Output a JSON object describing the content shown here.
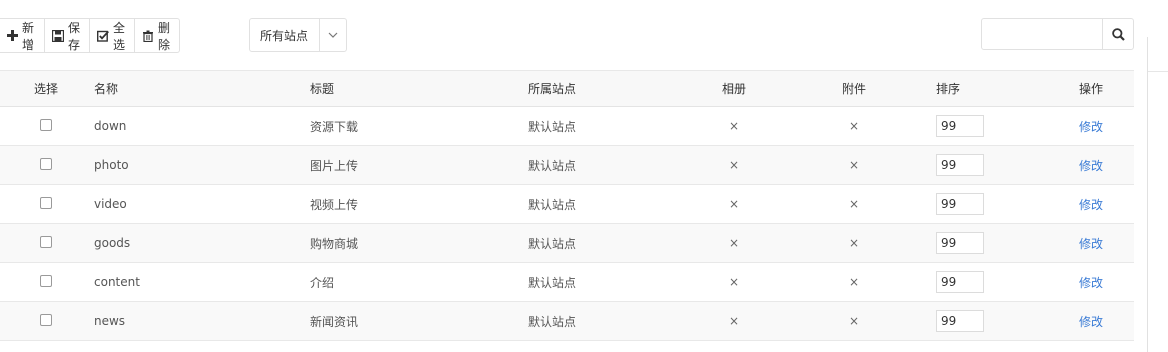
{
  "toolbar": {
    "buttons": [
      {
        "label": "新增",
        "icon": "plus-icon"
      },
      {
        "label": "保存",
        "icon": "save-icon"
      },
      {
        "label": "全选",
        "icon": "check-square-icon"
      },
      {
        "label": "删除",
        "icon": "trash-icon"
      }
    ],
    "site_select": {
      "value": "所有站点"
    },
    "search": {
      "placeholder": "",
      "value": ""
    }
  },
  "table": {
    "headers": {
      "select": "选择",
      "name": "名称",
      "title": "标题",
      "site": "所属站点",
      "album": "相册",
      "attachment": "附件",
      "sort": "排序",
      "action": "操作"
    },
    "rows": [
      {
        "name": "down",
        "title": "资源下载",
        "site": "默认站点",
        "album": "×",
        "attachment": "×",
        "sort": "99",
        "action": "修改"
      },
      {
        "name": "photo",
        "title": "图片上传",
        "site": "默认站点",
        "album": "×",
        "attachment": "×",
        "sort": "99",
        "action": "修改"
      },
      {
        "name": "video",
        "title": "视频上传",
        "site": "默认站点",
        "album": "×",
        "attachment": "×",
        "sort": "99",
        "action": "修改"
      },
      {
        "name": "goods",
        "title": "购物商城",
        "site": "默认站点",
        "album": "×",
        "attachment": "×",
        "sort": "99",
        "action": "修改"
      },
      {
        "name": "content",
        "title": "介绍",
        "site": "默认站点",
        "album": "×",
        "attachment": "×",
        "sort": "99",
        "action": "修改"
      },
      {
        "name": "news",
        "title": "新闻资讯",
        "site": "默认站点",
        "album": "×",
        "attachment": "×",
        "sort": "99",
        "action": "修改"
      }
    ]
  },
  "colors": {
    "link": "#3a7bd5",
    "border": "#e1e1e1",
    "header_bg": "#f8f8f8"
  }
}
